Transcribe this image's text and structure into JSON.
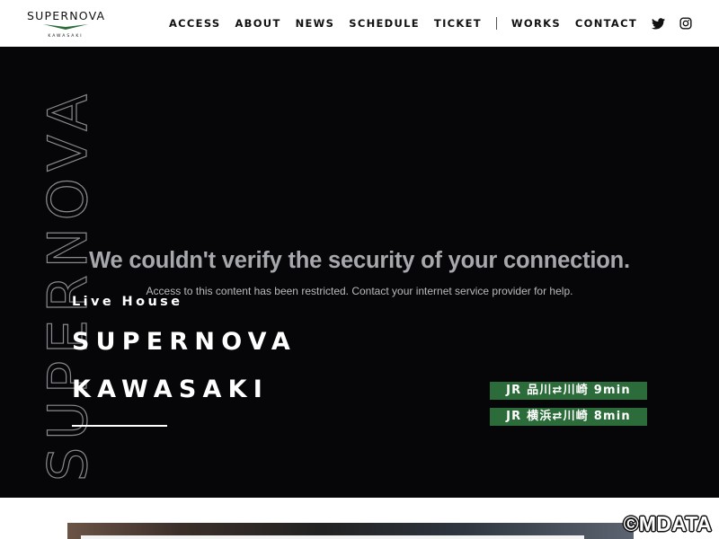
{
  "brand": {
    "name": "SUPERNOVA",
    "sub": "KAWASAKI",
    "mark_color": "#2c6b3a"
  },
  "nav": {
    "items": [
      {
        "label": "ACCESS"
      },
      {
        "label": "ABOUT"
      },
      {
        "label": "NEWS"
      },
      {
        "label": "SCHEDULE"
      },
      {
        "label": "TICKET"
      },
      {
        "label": "WORKS"
      },
      {
        "label": "CONTACT"
      }
    ],
    "icons": [
      "twitter-icon",
      "instagram-icon"
    ]
  },
  "hero": {
    "vertical_text": "SUPERNOVA",
    "error_title": "We couldn't verify the security of your connection.",
    "error_message": "Access to this content has been restricted. Contact your internet service provider for help.",
    "tagline": "Live House",
    "title_line1": "SUPERNOVA",
    "title_line2": "KAWASAKI",
    "badges": [
      {
        "text": "JR 品川⇄川崎 9min"
      },
      {
        "text": "JR 横浜⇄川崎 8min"
      }
    ],
    "background": "#060609",
    "badge_color": "#2c6b3a"
  },
  "watermark": "©MDATA"
}
